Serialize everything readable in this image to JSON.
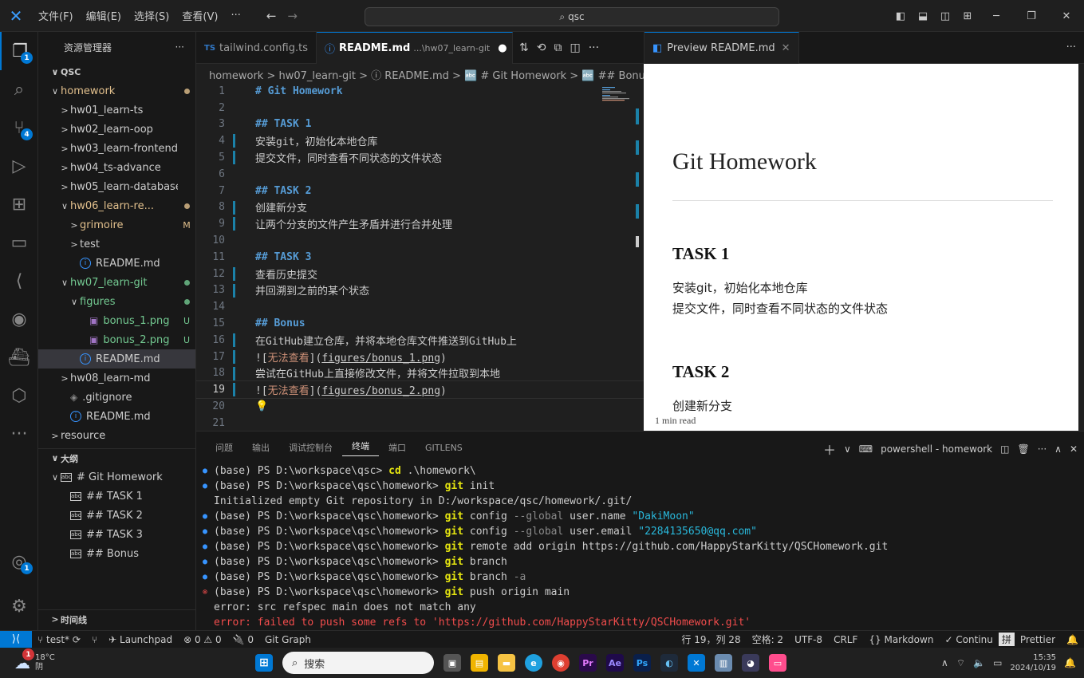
{
  "titlebar": {
    "menus": [
      "文件(F)",
      "编辑(E)",
      "选择(S)",
      "查看(V)",
      "···"
    ],
    "search": "qsc"
  },
  "activity": {
    "explorer_badge": "1",
    "scm_badge": "4",
    "account_badge": "1"
  },
  "sidebar": {
    "title": "资源管理器",
    "more": "···",
    "root": "QSC",
    "items": [
      {
        "label": "homework",
        "chev": "∨",
        "indent": 14,
        "status": "dot",
        "color": "#e2c08d"
      },
      {
        "label": "hw01_learn-ts",
        "chev": ">",
        "indent": 26,
        "status": "",
        "color": "#cccccc"
      },
      {
        "label": "hw02_learn-oop",
        "chev": ">",
        "indent": 26,
        "status": "",
        "color": "#cccccc"
      },
      {
        "label": "hw03_learn-frontend",
        "chev": ">",
        "indent": 26,
        "status": "",
        "color": "#cccccc"
      },
      {
        "label": "hw04_ts-advance",
        "chev": ">",
        "indent": 26,
        "status": "",
        "color": "#cccccc"
      },
      {
        "label": "hw05_learn-database",
        "chev": ">",
        "indent": 26,
        "status": "",
        "color": "#cccccc"
      },
      {
        "label": "hw06_learn-re...",
        "chev": "∨",
        "indent": 26,
        "status": "dot",
        "color": "#e2c08d"
      },
      {
        "label": "grimoire",
        "chev": ">",
        "indent": 38,
        "status": "M",
        "color": "#e2c08d"
      },
      {
        "label": "test",
        "chev": ">",
        "indent": 38,
        "status": "",
        "color": "#cccccc"
      },
      {
        "label": "README.md",
        "chev": "",
        "icon": "info",
        "indent": 38,
        "status": "",
        "color": "#cccccc"
      },
      {
        "label": "hw07_learn-git",
        "chev": "∨",
        "indent": 26,
        "status": "dot",
        "color": "#73c991"
      },
      {
        "label": "figures",
        "chev": "∨",
        "indent": 38,
        "status": "dot",
        "color": "#73c991"
      },
      {
        "label": "bonus_1.png",
        "chev": "",
        "icon": "image",
        "indent": 50,
        "status": "U",
        "color": "#73c991"
      },
      {
        "label": "bonus_2.png",
        "chev": "",
        "icon": "image",
        "indent": 50,
        "status": "U",
        "color": "#73c991"
      },
      {
        "label": "README.md",
        "chev": "",
        "icon": "info",
        "indent": 38,
        "status": "",
        "color": "#cccccc",
        "selected": true
      },
      {
        "label": "hw08_learn-md",
        "chev": ">",
        "indent": 26,
        "status": "",
        "color": "#cccccc"
      },
      {
        "label": ".gitignore",
        "chev": "",
        "icon": "diamond",
        "indent": 26,
        "status": "",
        "color": "#cccccc"
      },
      {
        "label": "README.md",
        "chev": "",
        "icon": "info",
        "indent": 26,
        "status": "",
        "color": "#cccccc"
      },
      {
        "label": "resource",
        "chev": ">",
        "indent": 14,
        "status": "",
        "color": "#cccccc"
      }
    ],
    "outline_title": "大纲",
    "outline": [
      {
        "label": "# Git Homework",
        "chev": "∨",
        "indent": 14
      },
      {
        "label": "## TASK 1",
        "chev": "",
        "indent": 40
      },
      {
        "label": "## TASK 2",
        "chev": "",
        "indent": 40
      },
      {
        "label": "## TASK 3",
        "chev": "",
        "indent": 40
      },
      {
        "label": "## Bonus",
        "chev": "",
        "indent": 40
      }
    ],
    "timeline_title": "时间线"
  },
  "tabs": [
    {
      "prefix": "TS",
      "label": "tailwind.config.ts",
      "active": false
    },
    {
      "prefix": "ⓘ",
      "label": "README.md",
      "suffix": "...\\hw07_learn-git",
      "active": true
    }
  ],
  "breadcrumb": "homework > hw07_learn-git > ⓘ README.md > 🔤 # Git Homework > 🔤 ## Bonus",
  "editor": {
    "lines": [
      {
        "n": "1",
        "t": "# Git Homework",
        "k": "hd",
        "m": false
      },
      {
        "n": "2",
        "t": "",
        "k": "",
        "m": false
      },
      {
        "n": "3",
        "t": "## TASK 1",
        "k": "hd",
        "m": false
      },
      {
        "n": "4",
        "t": "安装git，初始化本地仓库",
        "k": "",
        "m": true
      },
      {
        "n": "5",
        "t": "提交文件，同时查看不同状态的文件状态",
        "k": "",
        "m": true
      },
      {
        "n": "6",
        "t": "",
        "k": "",
        "m": false
      },
      {
        "n": "7",
        "t": "## TASK 2",
        "k": "hd",
        "m": false
      },
      {
        "n": "8",
        "t": "创建新分支",
        "k": "",
        "m": true
      },
      {
        "n": "9",
        "t": "让两个分支的文件产生矛盾并进行合并处理",
        "k": "",
        "m": true
      },
      {
        "n": "10",
        "t": "",
        "k": "",
        "m": false
      },
      {
        "n": "11",
        "t": "## TASK 3",
        "k": "hd",
        "m": false
      },
      {
        "n": "12",
        "t": "查看历史提交",
        "k": "",
        "m": true
      },
      {
        "n": "13",
        "t": "并回溯到之前的某个状态",
        "k": "",
        "m": true
      },
      {
        "n": "14",
        "t": "",
        "k": "",
        "m": false
      },
      {
        "n": "15",
        "t": "## Bonus",
        "k": "hd",
        "m": false
      },
      {
        "n": "16",
        "t": "在GitHub建立仓库，并将本地仓库文件推送到GitHub上",
        "k": "",
        "m": true
      },
      {
        "n": "17",
        "t": "![无法查看](figures/bonus_1.png)",
        "k": "img",
        "m": true
      },
      {
        "n": "18",
        "t": "尝试在GitHub上直接修改文件，并将文件拉取到本地",
        "k": "",
        "m": true
      },
      {
        "n": "19",
        "t": "![无法查看](figures/bonus_2.png)",
        "k": "img",
        "m": true,
        "cur": true
      },
      {
        "n": "20",
        "t": "💡",
        "k": "bulb",
        "m": false
      },
      {
        "n": "21",
        "t": "",
        "k": "",
        "m": false
      }
    ]
  },
  "preview": {
    "tab": "Preview README.md",
    "h1": "Git Homework",
    "task1_title": "TASK 1",
    "task1_l1": "安装git，初始化本地仓库",
    "task1_l2": "提交文件，同时查看不同状态的文件状态",
    "task2_title": "TASK 2",
    "task2_l1": "创建新分支",
    "read_time": "1 min read"
  },
  "panel": {
    "tabs": [
      "问题",
      "输出",
      "调试控制台",
      "终端",
      "端口",
      "GITLENS"
    ],
    "active_tab": "终端",
    "terminal_name": "powershell - homework",
    "lines": [
      {
        "d": "blue",
        "p": "(base) PS D:\\workspace\\qsc> ",
        "c": "cd",
        "a": " .\\homework\\",
        "ac": ""
      },
      {
        "d": "blue",
        "p": "(base) PS D:\\workspace\\qsc\\homework> ",
        "c": "git",
        "a": " init",
        "ac": ""
      },
      {
        "d": "",
        "p": "Initialized empty Git repository in D:/workspace/qsc/homework/.git/",
        "c": "",
        "a": "",
        "ac": ""
      },
      {
        "d": "blue",
        "p": "(base) PS D:\\workspace\\qsc\\homework> ",
        "c": "git",
        "a": " config ",
        "g": "--global",
        "b": " user.name ",
        "s": "\"DakiMoon\""
      },
      {
        "d": "blue",
        "p": "(base) PS D:\\workspace\\qsc\\homework> ",
        "c": "git",
        "a": " config ",
        "g": "--global",
        "b": " user.email ",
        "s": "\"2284135650@qq.com\""
      },
      {
        "d": "blue",
        "p": "(base) PS D:\\workspace\\qsc\\homework> ",
        "c": "git",
        "a": " remote add origin https://github.com/HappyStarKitty/QSCHomework.git",
        "ac": ""
      },
      {
        "d": "blue",
        "p": "(base) PS D:\\workspace\\qsc\\homework> ",
        "c": "git",
        "a": " branch",
        "ac": ""
      },
      {
        "d": "blue",
        "p": "(base) PS D:\\workspace\\qsc\\homework> ",
        "c": "git",
        "a": " branch ",
        "g": "-a",
        "b": "",
        "s": ""
      },
      {
        "d": "red",
        "p": "(base) PS D:\\workspace\\qsc\\homework> ",
        "c": "git",
        "a": " push origin main",
        "ac": ""
      },
      {
        "d": "",
        "p": "error: src refspec main does not match any",
        "c": "",
        "a": "",
        "ac": ""
      },
      {
        "d": "",
        "p": "",
        "e": "error: failed to push some refs to 'https://github.com/HappyStarKitty/QSCHomework.git'"
      }
    ]
  },
  "status": {
    "branch": "test*",
    "launchpad": "Launchpad",
    "problems": "⊗ 0 ⚠ 0",
    "ports": "🔌 0",
    "gitgraph": "Git Graph",
    "position": "行 19，列 28",
    "spaces": "空格: 2",
    "encoding": "UTF-8",
    "eol": "CRLF",
    "language": "Markdown",
    "continue": "Continu",
    "ime": "拼",
    "prettier": "Prettier"
  },
  "taskbar": {
    "temp": "18°C",
    "weather": "阴",
    "weather_badge": "1",
    "search": "搜索",
    "time": "15:35",
    "date": "2024/10/19"
  }
}
